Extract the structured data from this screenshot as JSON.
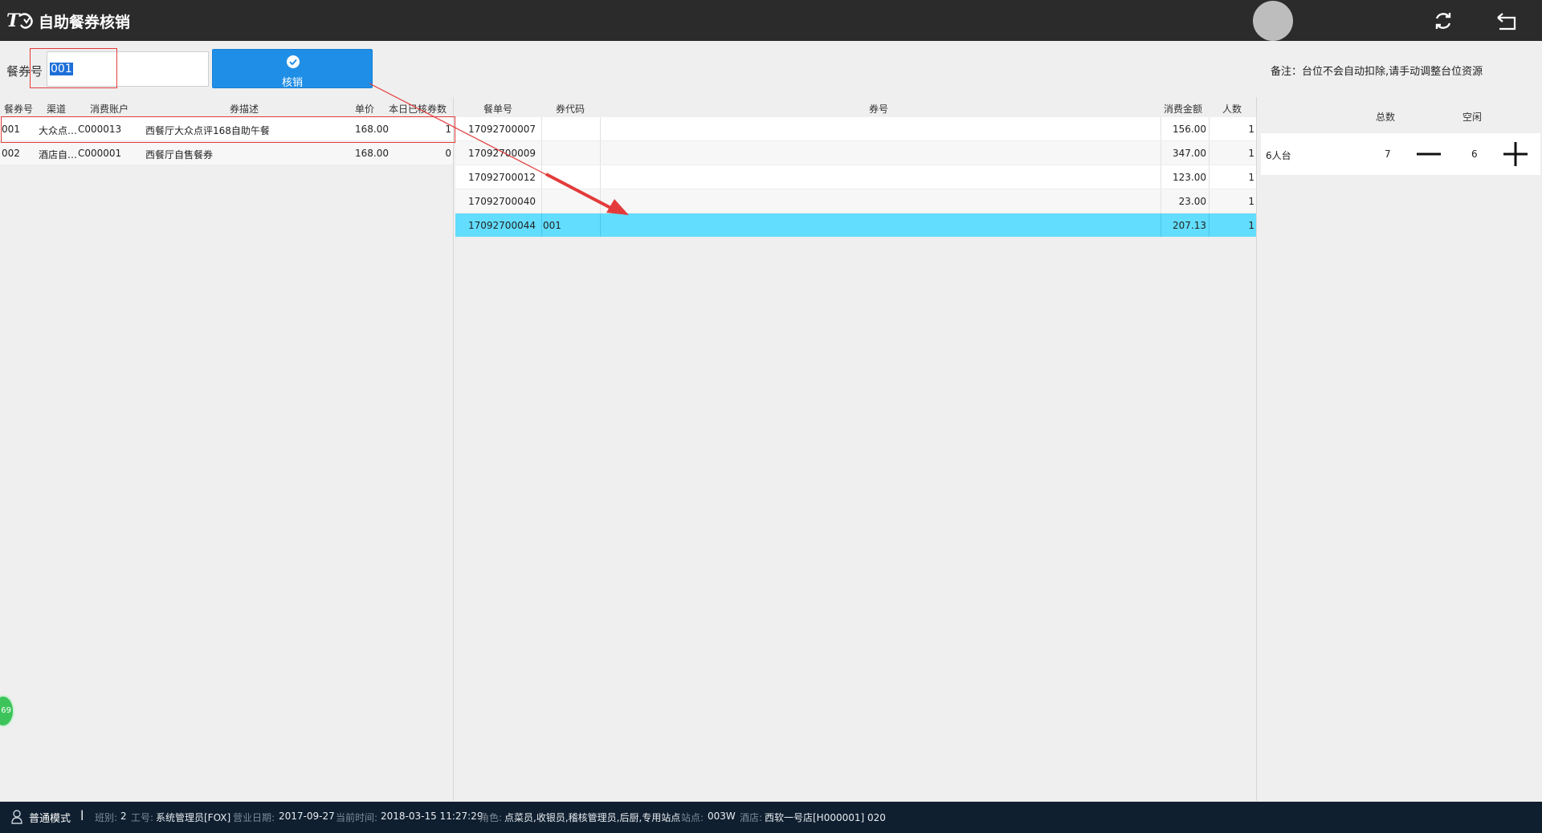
{
  "titlebar": {
    "title": "自助餐券核销"
  },
  "toolbar": {
    "ticket_label": "餐券号",
    "ticket_value": "001",
    "redeem_label": "核销",
    "note": "备注：台位不会自动扣除,请手动调整台位资源"
  },
  "left_table": {
    "columns": [
      "餐券号",
      "渠道",
      "消费账户",
      "券描述",
      "单价",
      "本日已核券数"
    ],
    "rows": [
      {
        "code": "001",
        "channel": "大众点…",
        "account": "C000013",
        "desc": "西餐厅大众点评168自助午餐",
        "price": "168.00",
        "count": "1"
      },
      {
        "code": "002",
        "channel": "酒店自…",
        "account": "C000001",
        "desc": "西餐厅自售餐券",
        "price": "168.00",
        "count": "0"
      }
    ]
  },
  "mid_table": {
    "columns": [
      "餐单号",
      "券代码",
      "券号",
      "消费金额",
      "人数"
    ],
    "rows": [
      {
        "order": "17092700007",
        "code": "",
        "number": "",
        "amount": "156.00",
        "people": "1"
      },
      {
        "order": "17092700009",
        "code": "",
        "number": "",
        "amount": "347.00",
        "people": "1"
      },
      {
        "order": "17092700012",
        "code": "",
        "number": "",
        "amount": "123.00",
        "people": "1"
      },
      {
        "order": "17092700040",
        "code": "",
        "number": "",
        "amount": "23.00",
        "people": "1"
      },
      {
        "order": "17092700044",
        "code": "001",
        "number": "",
        "amount": "207.13",
        "people": "1"
      }
    ],
    "selected_row": 4
  },
  "right_panel": {
    "columns": [
      "总数",
      "空闲"
    ],
    "rows": [
      {
        "name": "6人台",
        "total": "7",
        "free": "6"
      }
    ]
  },
  "badge": {
    "text": "69"
  },
  "statusbar": {
    "mode": "普通模式",
    "shift_label": "班别:",
    "shift": "2",
    "staff_label": "工号:",
    "staff": "系统管理员[FOX]",
    "bizdate_label": "营业日期:",
    "bizdate": "2017-09-27",
    "time_label": "当前时间:",
    "time": "2018-03-15 11:27:29",
    "role_label": "角色:",
    "role": "点菜员,收银员,稽核管理员,后厨,专用站点",
    "station_label": "站点:",
    "station": "003W",
    "hotel_label": "酒店:",
    "hotel": "西软一号店[H000001] 020"
  },
  "colors": {
    "titlebar": "#2b2b2b",
    "button": "#1f8ee6",
    "selected_row": "#62ddfd",
    "statusbar": "#0f1f30",
    "annotation": "#e33b3b"
  },
  "icons": [
    "logo-icon",
    "refresh-icon",
    "back-icon",
    "check-icon",
    "minus-icon",
    "plus-icon",
    "user-icon"
  ]
}
